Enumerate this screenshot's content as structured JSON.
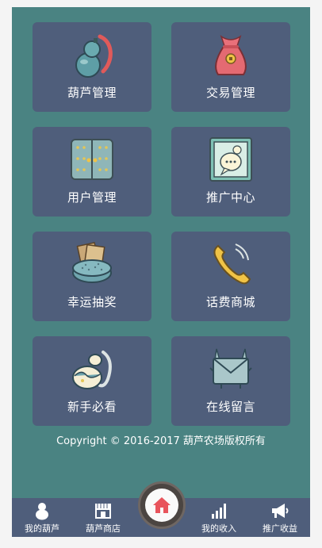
{
  "tiles": [
    {
      "label": "葫芦管理",
      "icon": "gourd-icon"
    },
    {
      "label": "交易管理",
      "icon": "money-bag-icon"
    },
    {
      "label": "用户管理",
      "icon": "door-icon"
    },
    {
      "label": "推广中心",
      "icon": "chat-bubble-icon"
    },
    {
      "label": "幸运抽奖",
      "icon": "lottery-icon"
    },
    {
      "label": "话费商城",
      "icon": "phone-icon"
    },
    {
      "label": "新手必看",
      "icon": "egg-icon"
    },
    {
      "label": "在线留言",
      "icon": "message-monster-icon"
    }
  ],
  "copyright": "Copyright © 2016-2017 葫芦农场版权所有",
  "nav": {
    "items": [
      {
        "label": "我的葫芦",
        "icon": "gourd-silhouette-icon"
      },
      {
        "label": "葫芦商店",
        "icon": "shop-icon"
      },
      {
        "label": "我的收入",
        "icon": "bar-signal-icon"
      },
      {
        "label": "推广收益",
        "icon": "megaphone-icon"
      }
    ],
    "home_icon": "home-icon"
  },
  "colors": {
    "background": "#4a8382",
    "tile": "#4f5e7b",
    "home_accent": "#e8545c"
  }
}
